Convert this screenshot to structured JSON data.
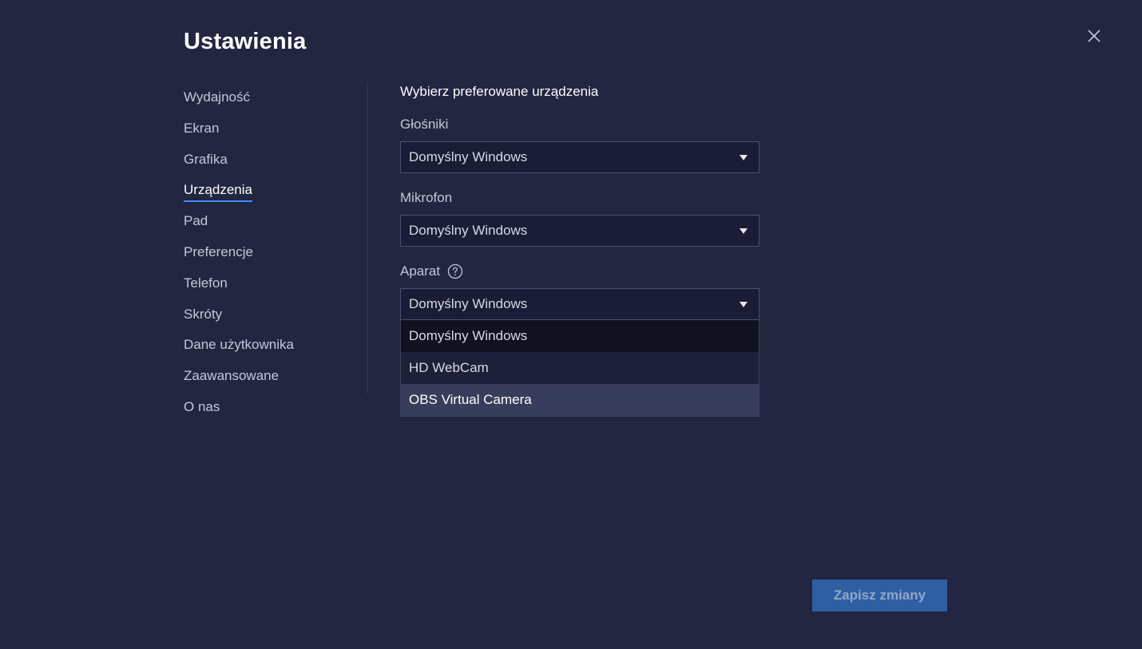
{
  "title": "Ustawienia",
  "close_icon": "close-icon",
  "nav": {
    "items": [
      {
        "label": "Wydajność",
        "active": false
      },
      {
        "label": "Ekran",
        "active": false
      },
      {
        "label": "Grafika",
        "active": false
      },
      {
        "label": "Urządzenia",
        "active": true
      },
      {
        "label": "Pad",
        "active": false
      },
      {
        "label": "Preferencje",
        "active": false
      },
      {
        "label": "Telefon",
        "active": false
      },
      {
        "label": "Skróty",
        "active": false
      },
      {
        "label": "Dane użytkownika",
        "active": false
      },
      {
        "label": "Zaawansowane",
        "active": false
      },
      {
        "label": "O nas",
        "active": false
      }
    ]
  },
  "devices": {
    "section_title": "Wybierz preferowane urządzenia",
    "speakers": {
      "label": "Głośniki",
      "value": "Domyślny Windows"
    },
    "microphone": {
      "label": "Mikrofon",
      "value": "Domyślny Windows"
    },
    "camera": {
      "label": "Aparat",
      "help_icon": "help-circle-icon",
      "value": "Domyślny Windows",
      "options": [
        "Domyślny Windows",
        "HD WebCam",
        "OBS Virtual Camera"
      ],
      "hovered_option": "OBS Virtual Camera"
    }
  },
  "save_button": "Zapisz zmiany",
  "colors": {
    "background": "#222641",
    "accent": "#3f8cff",
    "save_button_bg": "#2f5fa3"
  }
}
